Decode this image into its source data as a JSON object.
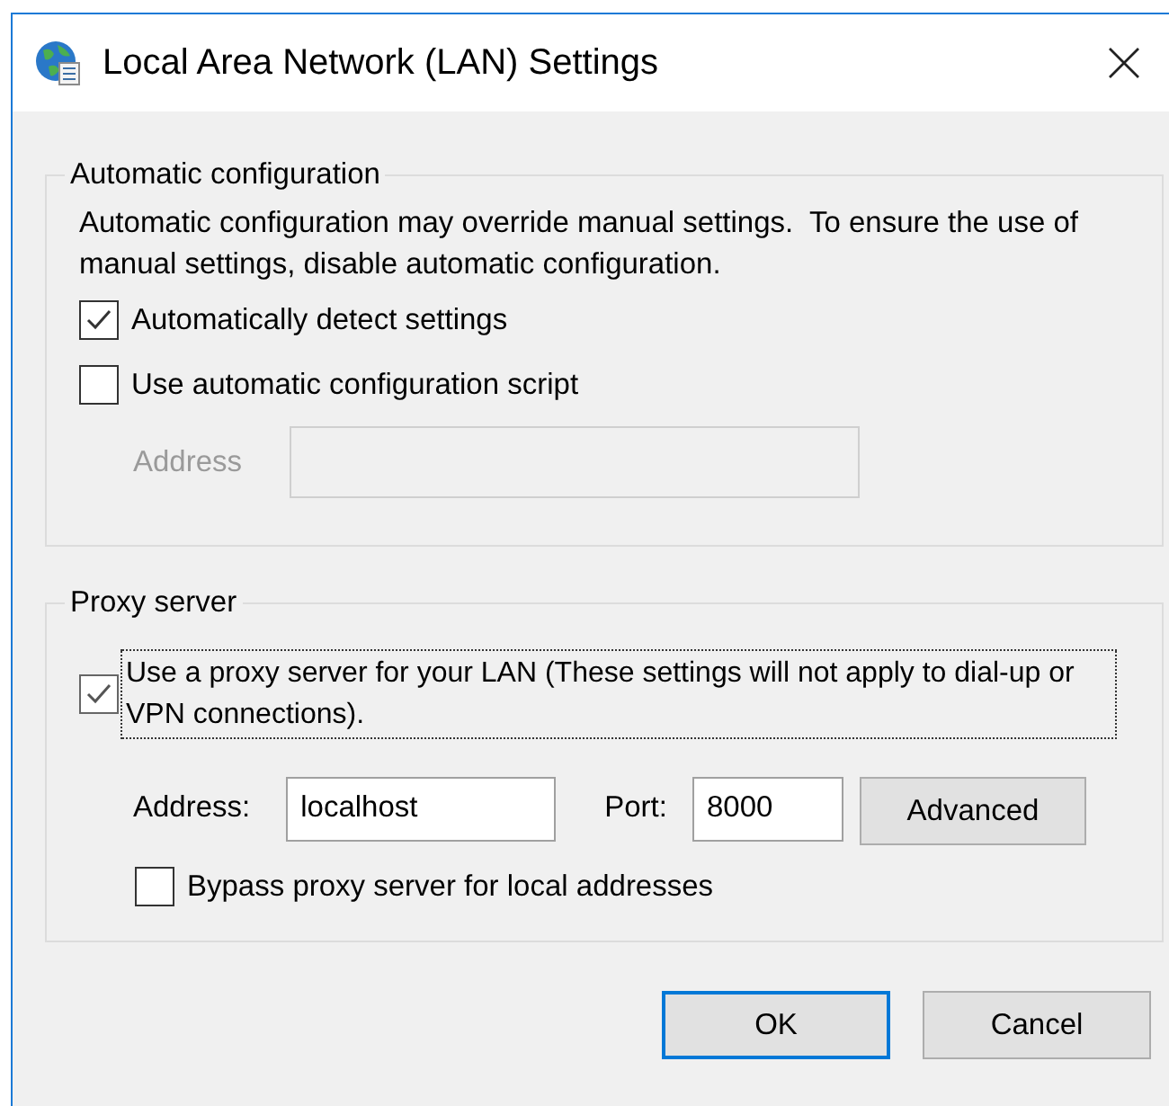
{
  "window": {
    "title": "Local Area Network (LAN) Settings"
  },
  "automatic_configuration": {
    "title": "Automatic configuration",
    "description": "Automatic configuration may override manual settings.  To ensure the use of manual settings, disable automatic configuration.",
    "options": [
      {
        "label": "Automatically detect settings",
        "checked": true
      },
      {
        "label": "Use automatic configuration script",
        "checked": false
      }
    ],
    "script_address": {
      "label": "Address",
      "disabled": true
    }
  },
  "proxy_server": {
    "title": "Proxy server",
    "use_proxy": {
      "label": "Use a proxy server for your LAN (These settings will not apply to dial-up or VPN connections).",
      "checked": true,
      "focused": true
    },
    "address": {
      "label": "Address:",
      "value": "localhost"
    },
    "port": {
      "label": "Port:",
      "value": "8000"
    },
    "advanced_button": "Advanced",
    "bypass": {
      "label": "Bypass proxy server for local addresses",
      "checked": false
    }
  },
  "buttons": [
    {
      "label": "OK",
      "default": true
    },
    {
      "label": "Cancel",
      "default": false
    }
  ]
}
